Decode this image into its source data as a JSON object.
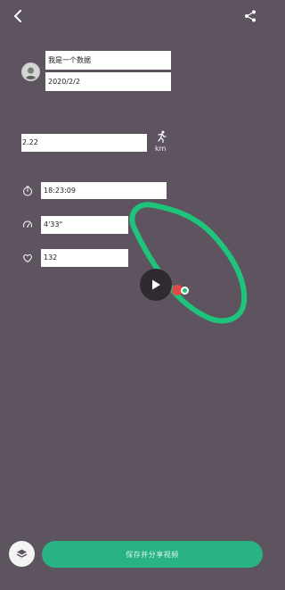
{
  "header": {
    "back_icon": "chevron-left-icon",
    "share_icon": "share-icon"
  },
  "profile": {
    "name": "我是一个数据",
    "date": "2020/2/2"
  },
  "distance": {
    "value": "2.22",
    "unit": "km",
    "icon": "running-person-icon"
  },
  "stats": {
    "duration": "18:23:09",
    "pace": "4'33\"",
    "heart_rate": "132",
    "duration_icon": "stopwatch-icon",
    "pace_icon": "speedometer-icon",
    "heart_icon": "heart-rate-icon"
  },
  "route": {
    "color": "#1ec47b",
    "marker_color": "#e14b47",
    "play_icon": "play-icon"
  },
  "footer": {
    "left_icon": "layers-icon",
    "save_label": "保存并分享视频",
    "save_color": "#29b384"
  },
  "theme": {
    "background": "#5d5460"
  }
}
